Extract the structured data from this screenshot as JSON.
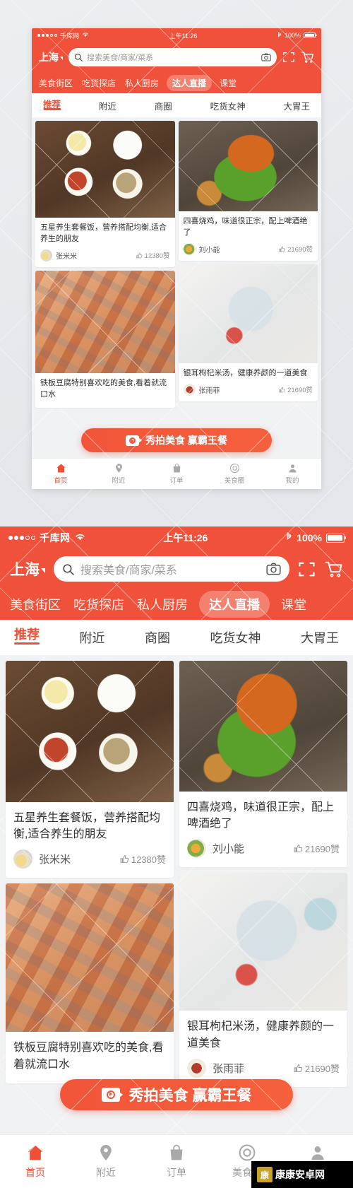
{
  "status_bar": {
    "carrier": "千库网",
    "time": "上午11:26",
    "battery": "100%",
    "signal_dots_filled": 3,
    "signal_dots_hollow": 2,
    "wifi_icon": "wifi-icon",
    "bluetooth_icon": "bluetooth-icon",
    "battery_icon": "battery-icon"
  },
  "header": {
    "city": "上海",
    "search_placeholder": "搜索美食/商家/菜系",
    "search_value": "",
    "search_icon": "search-icon",
    "camera_icon": "camera-icon",
    "scan_icon": "scan-icon",
    "cart_icon": "cart-icon"
  },
  "category_nav": {
    "items": [
      {
        "label": "美食街区",
        "active": false
      },
      {
        "label": "吃货探店",
        "active": false
      },
      {
        "label": "私人厨房",
        "active": false
      },
      {
        "label": "达人直播",
        "active": true
      },
      {
        "label": "课堂",
        "active": false
      }
    ]
  },
  "sub_tabs": {
    "items": [
      {
        "label": "推荐",
        "active": true
      },
      {
        "label": "附近",
        "active": false
      },
      {
        "label": "商圈",
        "active": false
      },
      {
        "label": "吃货女神",
        "active": false
      },
      {
        "label": "大胃王",
        "active": false
      }
    ]
  },
  "feed": {
    "left_column": [
      {
        "title": "五星养生套餐饭，营养搭配均衡,适合养生的朋友",
        "author": "张米米",
        "likes": "12380赞",
        "like_icon": "thumbs-up-icon",
        "image_name": "meal-set-bowls-photo"
      },
      {
        "title": "铁板豆腐特别喜欢吃的美食,看着就流口水",
        "author": "",
        "likes": "",
        "like_icon": "thumbs-up-icon",
        "image_name": "grilled-tofu-photo"
      }
    ],
    "right_column": [
      {
        "title": "四喜烧鸡，味道很正宗，配上啤酒绝了",
        "author": "刘小能",
        "likes": "21690赞",
        "like_icon": "thumbs-up-icon",
        "image_name": "roast-chicken-photo"
      },
      {
        "title": "银耳枸杞米汤，健康养颜的一道美食",
        "author": "张雨菲",
        "likes": "21690赞",
        "like_icon": "thumbs-up-icon",
        "image_name": "tremella-wolfberry-soup-photo"
      }
    ]
  },
  "cta": {
    "label": "秀拍美食 赢霸王餐",
    "icon": "video-camera-icon"
  },
  "tab_bar": {
    "items": [
      {
        "label": "首页",
        "icon": "home-icon",
        "active": true
      },
      {
        "label": "附近",
        "icon": "location-pin-icon",
        "active": false
      },
      {
        "label": "订单",
        "icon": "shopping-bag-icon",
        "active": false
      },
      {
        "label": "美食圈",
        "icon": "circle-target-icon",
        "active": false
      },
      {
        "label": "我的",
        "icon": "user-icon",
        "active": false
      }
    ]
  },
  "watermark": {
    "corner_badge": "康康安卓网"
  },
  "colors": {
    "brand": "#f0513a",
    "accent": "#ef4f35",
    "page_bg": "#e9eaec",
    "card_bg": "#ffffff"
  }
}
